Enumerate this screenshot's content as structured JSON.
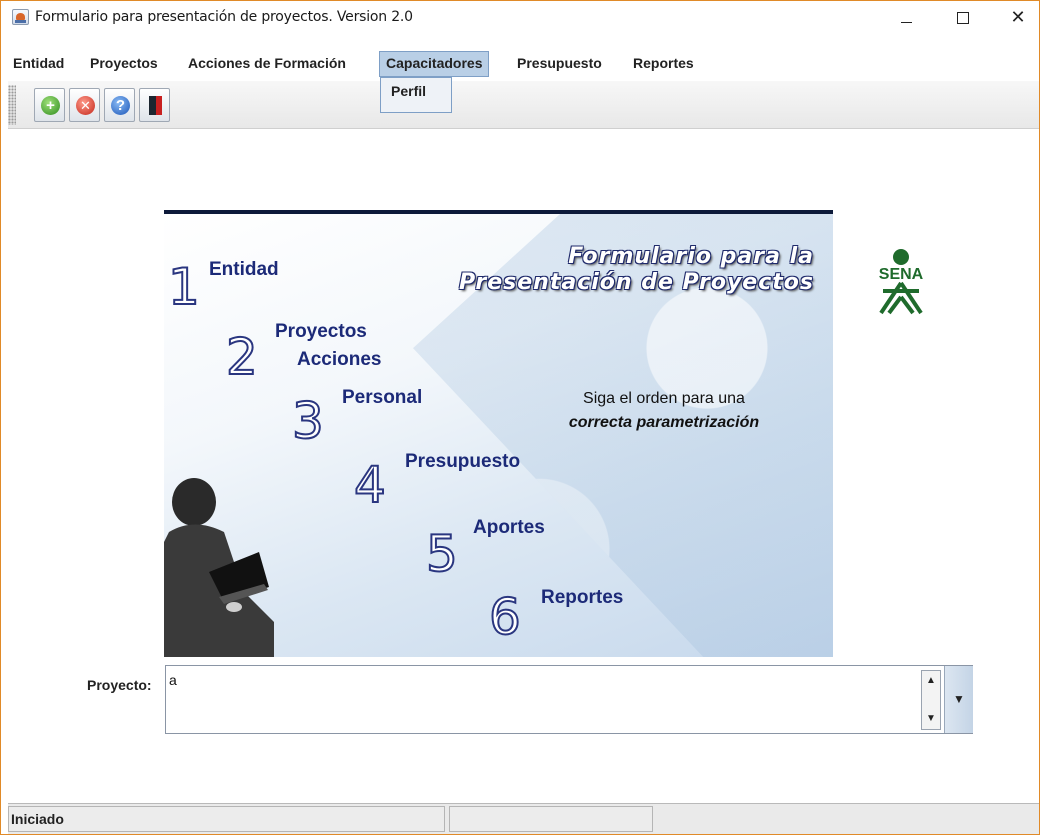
{
  "window": {
    "title": "Formulario para presentación de proyectos. Version 2.0",
    "close_glyph": "✕"
  },
  "menu": {
    "items": [
      "Entidad",
      "Proyectos",
      "Acciones de Formación",
      "Capacitadores",
      "Presupuesto",
      "Reportes"
    ],
    "active": "Capacitadores",
    "dropdown": [
      "Perfil"
    ]
  },
  "toolbar": {
    "buttons": [
      {
        "icon": "add-icon",
        "glyph": "+"
      },
      {
        "icon": "delete-icon",
        "glyph": "✕"
      },
      {
        "icon": "help-icon",
        "glyph": "?"
      },
      {
        "icon": "exit-door-icon",
        "glyph": ""
      }
    ]
  },
  "splash": {
    "title_line1": "Formulario para la",
    "title_line2": "Presentación de Proyectos",
    "steps": [
      {
        "num": "1",
        "label": "Entidad"
      },
      {
        "num": "2",
        "label": "Proyectos",
        "label2": "Acciones"
      },
      {
        "num": "3",
        "label": "Personal"
      },
      {
        "num": "4",
        "label": "Presupuesto"
      },
      {
        "num": "5",
        "label": "Aportes"
      },
      {
        "num": "6",
        "label": "Reportes"
      }
    ],
    "hint_line1": "Siga el orden para una",
    "hint_line2": "correcta parametrización",
    "logo_text": "SENA"
  },
  "project": {
    "label": "Proyecto:",
    "value": "a"
  },
  "status": {
    "text": "Iniciado",
    "cell2": ""
  },
  "colors": {
    "accent_border": "#e08a28",
    "menu_active": "#b9cfe6",
    "sena_green": "#1f6b2c",
    "step_blue": "#1c2a78"
  }
}
